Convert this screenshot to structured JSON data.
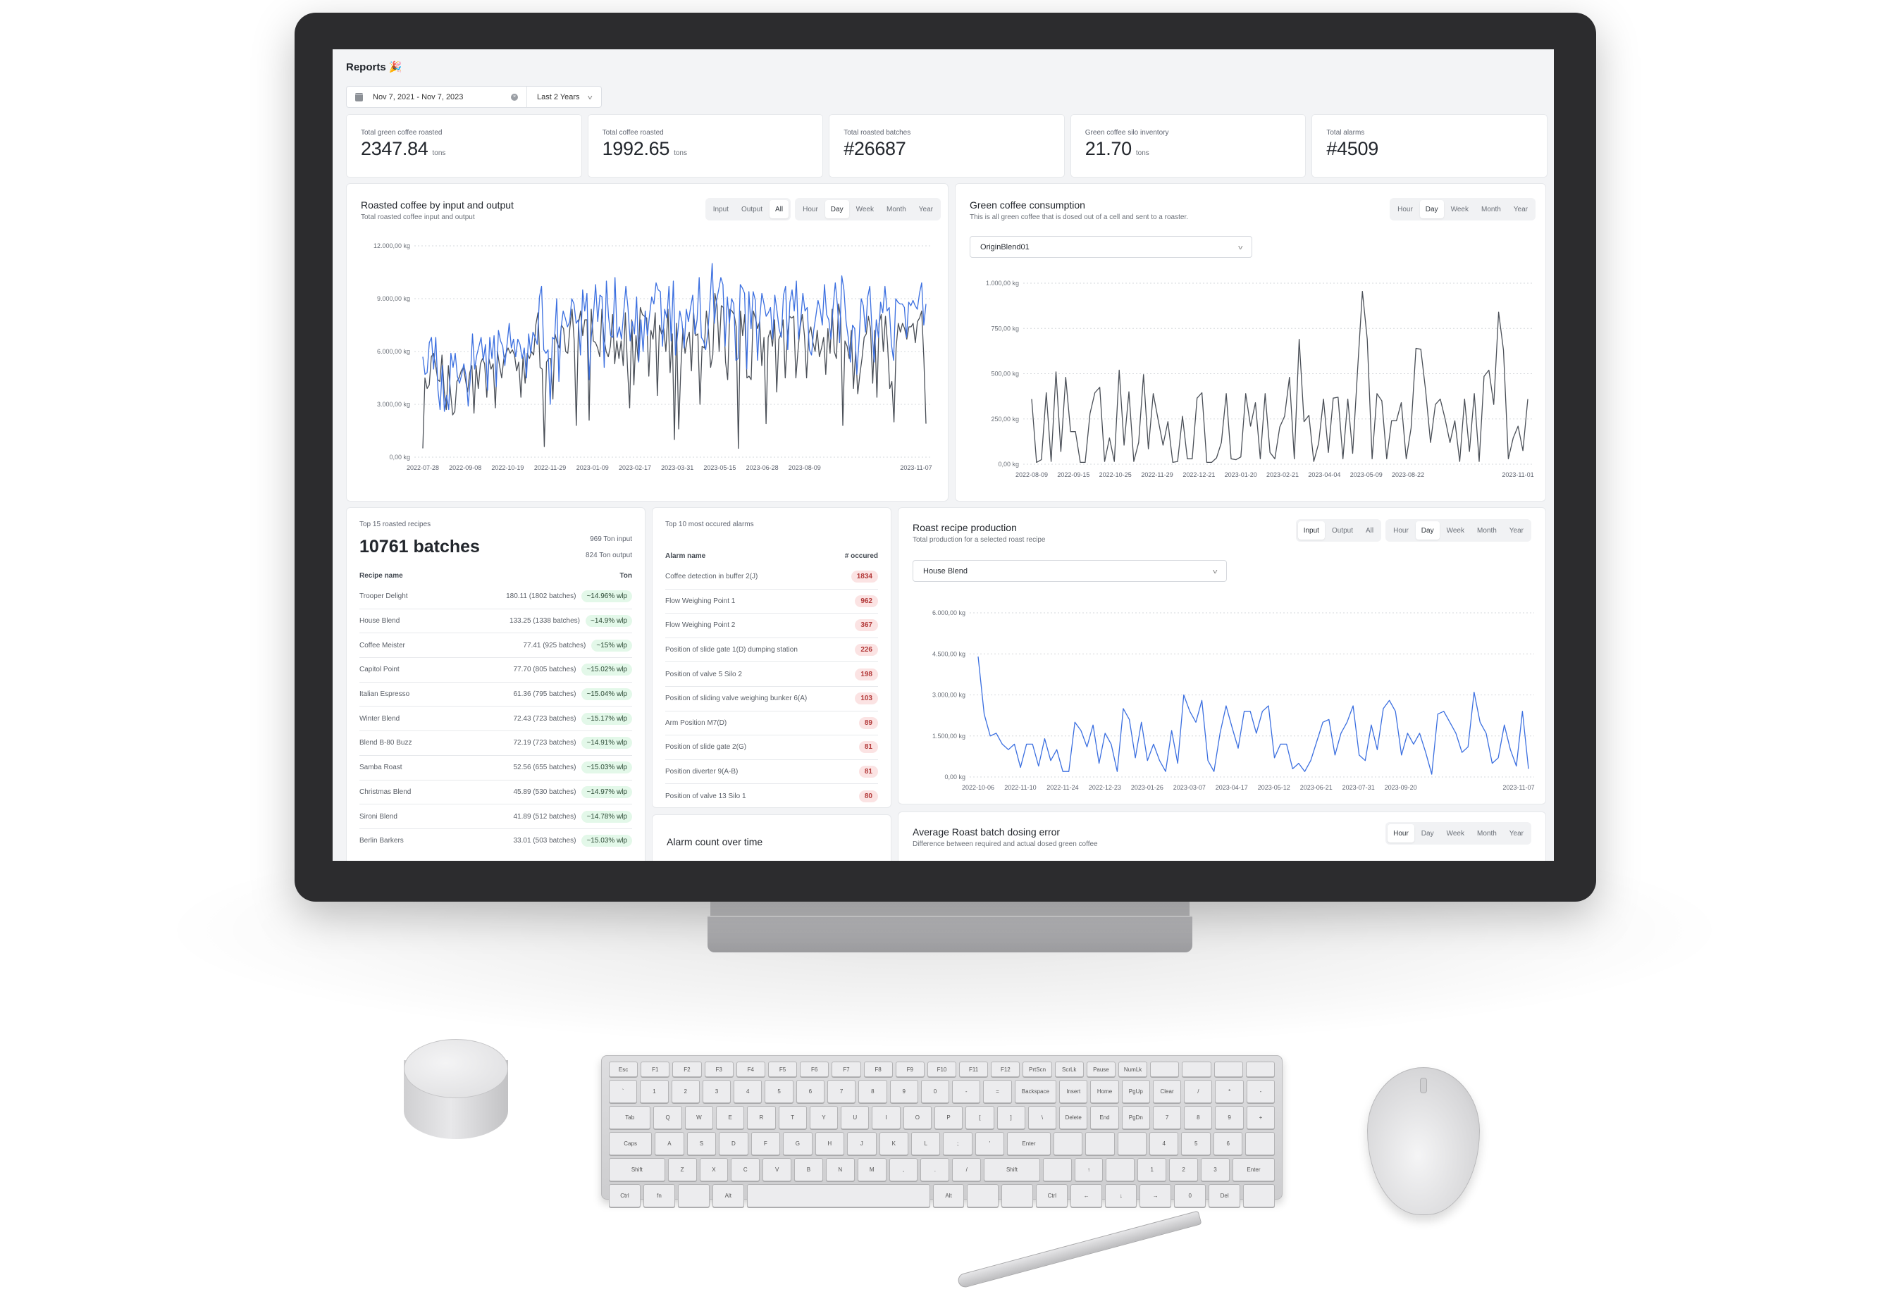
{
  "page": {
    "title": "Reports",
    "title_emoji": "🎉",
    "date_range": "Nov 7, 2021 - Nov 7, 2023",
    "preset": "Last 2 Years",
    "icons": {
      "calendar": "calendar-icon",
      "clear": "clear-icon",
      "chevron": "chevron-down-icon"
    }
  },
  "kpis": [
    {
      "label": "Total green coffee roasted",
      "value": "2347.84",
      "unit": "tons"
    },
    {
      "label": "Total coffee roasted",
      "value": "1992.65",
      "unit": "tons"
    },
    {
      "label": "Total roasted batches",
      "value": "#26687",
      "unit": ""
    },
    {
      "label": "Green coffee silo inventory",
      "value": "21.70",
      "unit": "tons"
    },
    {
      "label": "Total alarms",
      "value": "#4509",
      "unit": ""
    }
  ],
  "segments": {
    "mode": [
      "Input",
      "Output",
      "All"
    ],
    "period": [
      "Hour",
      "Day",
      "Week",
      "Month",
      "Year"
    ]
  },
  "cards": {
    "roasted": {
      "title": "Roasted coffee by input and output",
      "subtitle": "Total roasted coffee input and output",
      "mode_active": "All",
      "period_active": "Day"
    },
    "green": {
      "title": "Green coffee consumption",
      "subtitle": "This is all green coffee that is dosed out of a cell and sent to a roaster.",
      "period_active": "Day",
      "select_value": "OriginBlend01"
    },
    "recipe_prod": {
      "title": "Roast recipe production",
      "subtitle": "Total production for a selected roast recipe",
      "mode_active": "Input",
      "period_active": "Day",
      "select_value": "House Blend"
    },
    "dosing": {
      "title": "Average Roast batch dosing error",
      "subtitle": "Difference between required and actual dosed green coffee",
      "period_active": "Hour"
    },
    "alarm_time": {
      "title": "Alarm count over time"
    }
  },
  "recipes": {
    "caption": "Top 15 roasted recipes",
    "total": "10761 batches",
    "input": "969 Ton input",
    "output": "824 Ton output",
    "col_name": "Recipe name",
    "col_value": "Ton",
    "rows": [
      {
        "name": "Trooper Delight",
        "value": "180.11 (1802 batches)",
        "wlp": "~14.96% wlp"
      },
      {
        "name": "House Blend",
        "value": "133.25 (1338 batches)",
        "wlp": "~14.9% wlp"
      },
      {
        "name": "Coffee Meister",
        "value": "77.41 (925 batches)",
        "wlp": "~15% wlp"
      },
      {
        "name": "Capitol Point",
        "value": "77.70 (805 batches)",
        "wlp": "~15.02% wlp"
      },
      {
        "name": "Italian Espresso",
        "value": "61.36 (795 batches)",
        "wlp": "~15.04% wlp"
      },
      {
        "name": "Winter Blend",
        "value": "72.43 (723 batches)",
        "wlp": "~15.17% wlp"
      },
      {
        "name": "Blend B-80 Buzz",
        "value": "72.19 (723 batches)",
        "wlp": "~14.91% wlp"
      },
      {
        "name": "Samba Roast",
        "value": "52.56 (655 batches)",
        "wlp": "~15.03% wlp"
      },
      {
        "name": "Christmas Blend",
        "value": "45.89 (530 batches)",
        "wlp": "~14.97% wlp"
      },
      {
        "name": "Sironi Blend",
        "value": "41.89 (512 batches)",
        "wlp": "~14.78% wlp"
      },
      {
        "name": "Berlin Barkers",
        "value": "33.01 (503 batches)",
        "wlp": "~15.03% wlp"
      }
    ]
  },
  "alarms": {
    "caption": "Top 10 most occured alarms",
    "col_name": "Alarm name",
    "col_value": "# occured",
    "rows": [
      {
        "name": "Coffee detection in buffer 2(J)",
        "count": "1834"
      },
      {
        "name": "Flow Weighing Point 1",
        "count": "962"
      },
      {
        "name": "Flow Weighing Point 2",
        "count": "367"
      },
      {
        "name": "Position of slide gate 1(D) dumping station",
        "count": "226"
      },
      {
        "name": "Position of valve 5 Silo 2",
        "count": "198"
      },
      {
        "name": "Position of sliding valve weighing bunker 6(A)",
        "count": "103"
      },
      {
        "name": "Arm Position M7(D)",
        "count": "89"
      },
      {
        "name": "Position of slide gate 2(G)",
        "count": "81"
      },
      {
        "name": "Position diverter 9(A-B)",
        "count": "81"
      },
      {
        "name": "Position of valve 13 Silo 1",
        "count": "80"
      }
    ]
  },
  "colors": {
    "input_series": "#3b6fe0",
    "output_series": "#4a4f57",
    "wlp_pill": "#e3f8e9",
    "alarm_pill": "#fbe3e3",
    "alarm_text": "#b33a3a"
  },
  "chart_data": [
    {
      "id": "roasted",
      "type": "line",
      "title": "Roasted coffee by input and output",
      "ylabel": "kg",
      "ylim": [
        0,
        12000
      ],
      "yticks": [
        "0,00 kg",
        "3.000,00 kg",
        "6.000,00 kg",
        "9.000,00 kg",
        "12.000,00 kg"
      ],
      "xticks": [
        "2022-07-28",
        "2022-09-08",
        "2022-10-19",
        "2022-11-29",
        "2023-01-09",
        "2023-02-17",
        "2023-03-31",
        "2023-05-15",
        "2023-06-28",
        "2023-08-09",
        "2023-11-07"
      ],
      "grid": true,
      "series": [
        {
          "name": "Input",
          "color": "#3b6fe0",
          "values": [
            5700,
            4700,
            4800,
            6500,
            6800,
            5000,
            6800,
            3800,
            2700,
            5200,
            2600,
            3500,
            2700,
            5900,
            5100,
            5900,
            4600,
            4200,
            4700,
            5300,
            4600,
            2900,
            4500,
            7000,
            5000,
            5800,
            6300,
            6800,
            5500,
            6400,
            3800,
            6800,
            5600,
            6900,
            4000,
            7200,
            6600,
            6300,
            5200,
            6400,
            7600,
            6200,
            6700,
            5700,
            6700,
            6400,
            5600,
            6200,
            4500,
            7000,
            5900,
            7100,
            6800,
            6400,
            9100,
            9700,
            6100,
            5900,
            6100,
            3000,
            6800,
            6700,
            9000,
            4300,
            7300,
            8300,
            7900,
            7400,
            7700,
            9000,
            8700,
            7600,
            7800,
            5800,
            9500,
            8300,
            9300,
            4400,
            6800,
            8100,
            9800,
            7700,
            9200,
            9100,
            5100,
            10000,
            8000,
            6900,
            6800,
            10200,
            6800,
            7400,
            6700,
            8200,
            9700,
            8500,
            6600,
            7700,
            7000,
            9100,
            5400,
            7800,
            6000,
            8300,
            6900,
            8100,
            9100,
            8700,
            9900,
            9500,
            9400,
            6300,
            8400,
            7900,
            9700,
            6600,
            10000,
            5800,
            7000,
            8300,
            7700,
            6200,
            8400,
            7700,
            8500,
            9200,
            7000,
            7800,
            10200,
            6800,
            6600,
            6100,
            7100,
            8900,
            11000,
            7600,
            8900,
            9500,
            10200,
            9800,
            6300,
            9100,
            7600,
            9000,
            8700,
            5500,
            5600,
            9800,
            9600,
            9300,
            5000,
            9400,
            7300,
            9400,
            8900,
            5500,
            7800,
            9300,
            8700,
            8000,
            8200,
            8500,
            6700,
            9200,
            8300,
            7300,
            6800,
            9200,
            9700,
            6100,
            8800,
            9500,
            8300,
            10000,
            6700,
            7800,
            9300,
            8300,
            8500,
            6100,
            5800,
            7200,
            8000,
            8900,
            8400,
            7500,
            9800,
            8100,
            7800,
            6700,
            8500,
            9900,
            8600,
            6500,
            10300,
            9500,
            7700,
            6800,
            5400,
            7500,
            7300,
            4700,
            6600,
            9000,
            8600,
            7100,
            9100,
            9700,
            7200,
            5400,
            7800,
            6800,
            8800,
            8200,
            9700,
            8300,
            8500,
            6400,
            5500,
            9000,
            8800,
            8700,
            8700,
            8500,
            6800,
            8800,
            8600,
            8900,
            8600,
            8400,
            9300,
            9900,
            7500,
            8700
          ]
        },
        {
          "name": "Output",
          "color": "#4a4f57",
          "values": [
            500,
            4500,
            3900,
            4100,
            5700,
            5900,
            5200,
            4400,
            4300,
            5800,
            3800,
            2700,
            5200,
            3700,
            2400,
            2600,
            4300,
            4500,
            4900,
            5100,
            4400,
            3700,
            4800,
            5200,
            2500,
            5200,
            3900,
            5300,
            5600,
            5300,
            3400,
            5600,
            5000,
            5300,
            2800,
            6000,
            5200,
            4500,
            5600,
            5900,
            6200,
            5900,
            6100,
            5800,
            4900,
            5400,
            3400,
            5700,
            4200,
            5900,
            5600,
            6000,
            5800,
            7500,
            8200,
            5100,
            5000,
            600,
            5400,
            5600,
            5600,
            3300,
            7000,
            6500,
            6200,
            7500,
            7300,
            6000,
            5900,
            7400,
            8400,
            6600,
            1800,
            7600,
            8300,
            6900,
            7800,
            7800,
            2100,
            8400,
            6600,
            6500,
            6200,
            5700,
            8400,
            6700,
            6000,
            5700,
            6300,
            8100,
            5300,
            6600,
            5600,
            6600,
            5200,
            8200,
            5100,
            2800,
            7800,
            4100,
            6900,
            5500,
            8500,
            8100,
            8000,
            7900,
            4600,
            7200,
            6700,
            8200,
            3500,
            7500,
            7000,
            7300,
            6000,
            8400,
            4800,
            7000,
            1000,
            7600,
            1600,
            5000,
            7300,
            5900,
            6700,
            7100,
            4900,
            8200,
            6900,
            7000,
            3000,
            6300,
            6200,
            8300,
            7200,
            5100,
            5800,
            9300,
            8600,
            6000,
            8600,
            8500,
            5400,
            4400,
            8400,
            8300,
            8100,
            7400,
            500,
            8300,
            6900,
            8100,
            4500,
            4600,
            4400,
            8300,
            7900,
            7300,
            7700,
            5200,
            6800,
            1900,
            6800,
            7200,
            6300,
            7800,
            3700,
            6700,
            7000,
            7800,
            4500,
            6800,
            8000,
            7900,
            8000,
            4500,
            6100,
            7400,
            8100,
            6900,
            4500,
            7000,
            7400,
            6500,
            6000,
            7200,
            5700,
            6200,
            6800,
            4700,
            7300,
            5900,
            8400,
            6000,
            5600,
            8700,
            7900,
            1800,
            6600,
            6300,
            5600,
            7200,
            3900,
            6000,
            3600,
            4700,
            5600,
            6800,
            7000,
            8000,
            7300,
            4200,
            7200,
            3400,
            7600,
            8100,
            6000,
            8000,
            6400,
            3900,
            4300,
            2000,
            6200,
            7600,
            7100,
            7600,
            7300,
            6700,
            7400,
            7400,
            7600,
            6500,
            7700,
            7900,
            8300,
            5600,
            1900
          ]
        }
      ]
    },
    {
      "id": "green",
      "type": "line",
      "title": "Green coffee consumption",
      "ylabel": "kg",
      "ylim": [
        0,
        1000
      ],
      "yticks": [
        "0,00 kg",
        "250,00 kg",
        "500,00 kg",
        "750,00 kg",
        "1.000,00 kg"
      ],
      "xticks": [
        "2022-08-09",
        "2022-09-15",
        "2022-10-25",
        "2022-11-29",
        "2022-12-21",
        "2023-01-20",
        "2023-02-21",
        "2023-04-04",
        "2023-05-09",
        "2023-08-22",
        "2023-11-01"
      ],
      "grid": true,
      "series": [
        {
          "name": "OriginBlend01",
          "color": "#4a4f57",
          "values": [
            360,
            10,
            25,
            395,
            15,
            510,
            70,
            480,
            180,
            180,
            10,
            10,
            280,
            395,
            425,
            15,
            145,
            15,
            520,
            105,
            400,
            15,
            120,
            495,
            85,
            390,
            245,
            105,
            235,
            10,
            15,
            265,
            30,
            30,
            365,
            395,
            10,
            10,
            35,
            120,
            390,
            30,
            25,
            40,
            390,
            210,
            340,
            30,
            390,
            65,
            30,
            205,
            265,
            480,
            30,
            690,
            235,
            270,
            15,
            115,
            360,
            65,
            365,
            370,
            30,
            360,
            60,
            515,
            955,
            690,
            30,
            390,
            350,
            30,
            240,
            240,
            340,
            30,
            200,
            640,
            635,
            405,
            120,
            330,
            360,
            250,
            120,
            240,
            15,
            360,
            70,
            390,
            15,
            485,
            520,
            330,
            840,
            630,
            30,
            145,
            210,
            75,
            360
          ]
        }
      ]
    },
    {
      "id": "recipe_prod",
      "type": "line",
      "title": "Roast recipe production",
      "ylabel": "kg",
      "ylim": [
        0,
        6000
      ],
      "yticks": [
        "0,00 kg",
        "1.500,00 kg",
        "3.000,00 kg",
        "4.500,00 kg",
        "6.000,00 kg"
      ],
      "xticks": [
        "2022-10-06",
        "2022-11-10",
        "2022-11-24",
        "2022-12-23",
        "2023-01-26",
        "2023-03-07",
        "2023-04-17",
        "2023-05-12",
        "2023-06-21",
        "2023-07-31",
        "2023-09-20",
        "2023-11-07"
      ],
      "grid": true,
      "series": [
        {
          "name": "House Blend",
          "color": "#3b6fe0",
          "values": [
            4400,
            2300,
            1500,
            1600,
            1200,
            1000,
            1200,
            350,
            1200,
            1200,
            400,
            1400,
            600,
            1000,
            200,
            200,
            2000,
            1700,
            1100,
            1900,
            500,
            1600,
            1200,
            200,
            2500,
            2100,
            700,
            2000,
            600,
            1200,
            600,
            200,
            1700,
            500,
            3000,
            2400,
            2000,
            2800,
            600,
            200,
            1600,
            2600,
            1800,
            1050,
            2400,
            2400,
            1600,
            2400,
            2600,
            700,
            1200,
            1200,
            300,
            500,
            200,
            600,
            1300,
            2000,
            2100,
            800,
            1600,
            2000,
            2600,
            800,
            600,
            1900,
            1000,
            2500,
            2800,
            2400,
            800,
            1600,
            1200,
            1600,
            900,
            100,
            2300,
            2400,
            2000,
            1600,
            900,
            1100,
            3100,
            2000,
            1600,
            500,
            700,
            1900,
            1000,
            400,
            2400,
            300
          ]
        }
      ]
    }
  ]
}
